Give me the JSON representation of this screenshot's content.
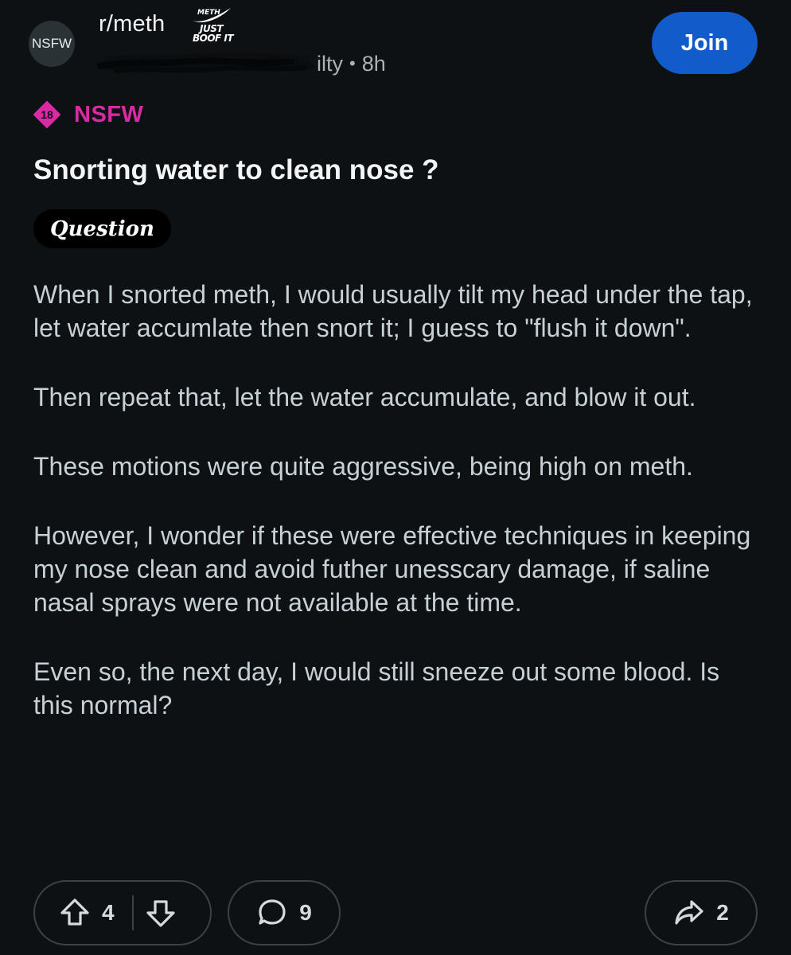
{
  "header": {
    "avatar_label": "NSFW",
    "subreddit": "r/meth",
    "user_flair": {
      "top": "METH",
      "line1": "JUST",
      "line2": "BOOF IT"
    },
    "author_visible_tail": "ilty",
    "separator": "•",
    "time": "8h",
    "join_label": "Join"
  },
  "nsfw": {
    "badge_number": "18",
    "label": "NSFW",
    "color": "#d92aa4"
  },
  "post": {
    "title": "Snorting water to clean nose ?",
    "flair": "Question",
    "paragraphs": [
      "When I snorted meth, I would usually tilt my head under the tap, let water accumlate then snort it; I guess to \"flush it down\".",
      "Then repeat that, let the water accumulate, and blow it out.",
      "These motions were quite aggressive, being high on meth.",
      "However, I wonder if these were effective techniques in keeping my nose clean and avoid futher unesscary damage, if saline nasal sprays were not available at the time.",
      "Even so, the next day, I would still sneeze out some blood. Is this normal?"
    ]
  },
  "actions": {
    "upvotes": "4",
    "comments": "9",
    "shares": "2"
  },
  "colors": {
    "background": "#0e1113",
    "join_button": "#115bca",
    "pill_border": "#3a4246"
  }
}
